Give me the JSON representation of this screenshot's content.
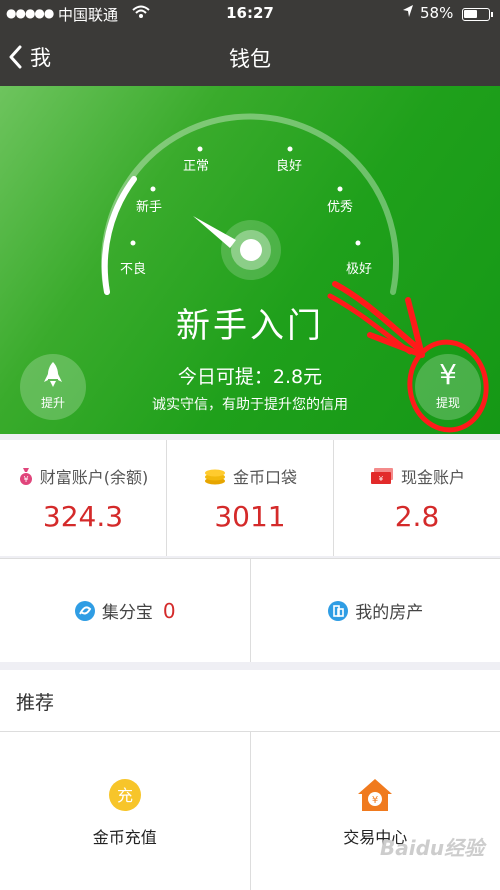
{
  "status_bar": {
    "carrier": "中国联通",
    "time": "16:27",
    "battery": "58%",
    "battery_level": 0.58
  },
  "nav": {
    "back_label": "我",
    "title": "钱包"
  },
  "gauge": {
    "labels": [
      "不良",
      "新手",
      "正常",
      "良好",
      "优秀",
      "极好"
    ],
    "level": "新手入门",
    "available": "今日可提：2.8元",
    "tip": "诚实守信，有助于提升您的信用",
    "upgrade_label": "提升",
    "withdraw_symbol": "¥",
    "withdraw_label": "提现"
  },
  "accounts": [
    {
      "label": "财富账户(余额)",
      "value": "324.3",
      "icon": "money-bag-icon"
    },
    {
      "label": "金币口袋",
      "value": "3011",
      "icon": "coins-icon"
    },
    {
      "label": "现金账户",
      "value": "2.8",
      "icon": "cash-envelope-icon"
    }
  ],
  "row2": {
    "points_label": "集分宝",
    "points_value": "0",
    "house_label": "我的房产"
  },
  "recommend": {
    "heading": "推荐",
    "items": [
      {
        "label": "金币充值",
        "icon_text": "充"
      },
      {
        "label": "交易中心",
        "icon_text": "¥"
      }
    ]
  },
  "watermark": "Baidu经验",
  "colors": {
    "hero_green": "#1fa01b",
    "value_red": "#d42a2a",
    "annotation_red": "#ff1a1a",
    "navbar": "#3b3a38"
  }
}
